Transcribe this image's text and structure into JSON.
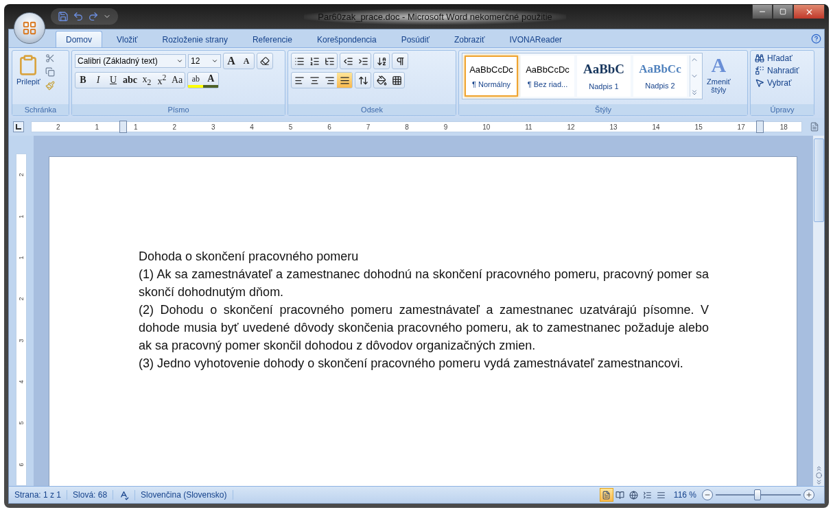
{
  "window": {
    "title": "Par60zak_prace.doc - Microsoft Word nekomerčné použitie"
  },
  "tabs": [
    {
      "label": "Domov",
      "selected": true
    },
    {
      "label": "Vložiť",
      "selected": false
    },
    {
      "label": "Rozloženie strany",
      "selected": false
    },
    {
      "label": "Referencie",
      "selected": false
    },
    {
      "label": "Korešpondencia",
      "selected": false
    },
    {
      "label": "Posúdiť",
      "selected": false
    },
    {
      "label": "Zobraziť",
      "selected": false
    },
    {
      "label": "IVONAReader",
      "selected": false
    }
  ],
  "clipboard": {
    "label": "Schránka",
    "paste": "Prilepiť"
  },
  "font": {
    "label": "Písmo",
    "font_name": "Calibri (Základný text)",
    "font_size": "12",
    "grow": "A",
    "shrink": "A",
    "format_buttons": [
      {
        "kind": "bold",
        "text": "B"
      },
      {
        "kind": "italic",
        "text": "I"
      },
      {
        "kind": "underline",
        "text": "U"
      },
      {
        "kind": "strike",
        "text": "abc"
      },
      {
        "kind": "sub",
        "text": "x$_{2}$"
      },
      {
        "kind": "sup",
        "text": "x$^{2}$"
      },
      {
        "kind": "case",
        "text": "Aa"
      }
    ],
    "highlight_text": "ab",
    "color_text": "A"
  },
  "paragraph": {
    "label": "Odsek",
    "align_buttons": [
      {
        "kind": "left",
        "selected": false
      },
      {
        "kind": "center",
        "selected": false
      },
      {
        "kind": "right",
        "selected": false
      },
      {
        "kind": "justify",
        "selected": true
      }
    ]
  },
  "styles": {
    "label": "Štýly",
    "change_glyph": "A",
    "change": [
      "Zmeniť",
      "štýly"
    ],
    "items": [
      {
        "kind": "normal",
        "preview": "AaBbCcDc",
        "name": "¶ Normálny",
        "selected": true
      },
      {
        "kind": "normal",
        "preview": "AaBbCcDc",
        "name": "¶ Bez riad...",
        "selected": false
      },
      {
        "kind": "heading1",
        "preview": "AaBbC",
        "name": "Nadpis 1",
        "selected": false
      },
      {
        "kind": "heading2",
        "preview": "AaBbCc",
        "name": "Nadpis 2",
        "selected": false
      }
    ]
  },
  "editing": {
    "label": "Úpravy",
    "items": [
      {
        "kind": "find",
        "text": "Hľadať"
      },
      {
        "kind": "replace",
        "text": "Nahradiť"
      },
      {
        "kind": "select",
        "text": "Vybrať"
      }
    ]
  },
  "ruler": {
    "numbers": [
      "2",
      "1",
      "1",
      "2",
      "3",
      "4",
      "5",
      "6",
      "7",
      "8",
      "9",
      "10",
      "11",
      "12",
      "13",
      "14",
      "15",
      "17",
      "18"
    ]
  },
  "vertical_ruler": {
    "numbers": [
      "2",
      "1",
      "1",
      "2",
      "3",
      "4",
      "5",
      "6"
    ]
  },
  "document": {
    "paragraphs": [
      "Dohoda o skončení pracovného pomeru",
      "(1) Ak sa zamestnávateľ a zamestnanec dohodnú na skončení pracovného pomeru, pracovný pomer sa skončí dohodnutým dňom.",
      "(2) Dohodu o skončení pracovného pomeru zamestnávateľ a zamestnanec uzatvárajú písomne. V dohode musia byť uvedené dôvody skončenia pracovného pomeru, ak to zamestnanec požaduje alebo ak sa pracovný pomer skončil dohodou z dôvodov organizačných zmien.",
      "(3) Jedno vyhotovenie dohody o skončení pracovného pomeru vydá zamestnávateľ zamestnancovi."
    ]
  },
  "status_bar": {
    "page": "Strana: 1 z 1",
    "words": "Slová: 68",
    "language": "Slovenčina (Slovensko)",
    "zoom": "116 %",
    "zoom_slider": {
      "level": 0.48
    },
    "views": [
      {
        "selected": true
      },
      {
        "selected": false
      },
      {
        "selected": false
      },
      {
        "selected": false
      },
      {
        "selected": false
      }
    ]
  }
}
